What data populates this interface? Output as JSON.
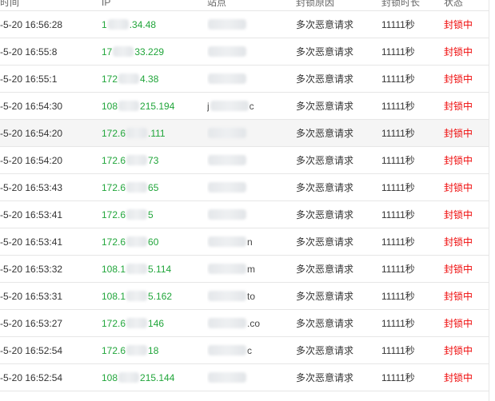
{
  "header": {
    "time": "时间",
    "ip": "IP",
    "site": "站点",
    "reason": "封锁原因",
    "duration": "封锁时长",
    "status": "状态"
  },
  "rows": [
    {
      "time": "-5-20 16:56:28",
      "ip_prefix": "1",
      "ip_suffix": ".34.48",
      "site_prefix": "",
      "site_suffix": "",
      "reason": "多次恶意请求",
      "duration": "11111秒",
      "status": "封锁中"
    },
    {
      "time": "-5-20 16:55:8",
      "ip_prefix": "17",
      "ip_suffix": "33.229",
      "site_prefix": "",
      "site_suffix": "",
      "reason": "多次恶意请求",
      "duration": "11111秒",
      "status": "封锁中"
    },
    {
      "time": "-5-20 16:55:1",
      "ip_prefix": "172",
      "ip_suffix": "4.38",
      "site_prefix": "",
      "site_suffix": "",
      "reason": "多次恶意请求",
      "duration": "11111秒",
      "status": "封锁中"
    },
    {
      "time": "-5-20 16:54:30",
      "ip_prefix": "108",
      "ip_suffix": "215.194",
      "site_prefix": "j",
      "site_suffix": "c",
      "reason": "多次恶意请求",
      "duration": "11111秒",
      "status": "封锁中"
    },
    {
      "time": "-5-20 16:54:20",
      "ip_prefix": "172.6",
      "ip_suffix": ".111",
      "site_prefix": "",
      "site_suffix": "",
      "reason": "多次恶意请求",
      "duration": "11111秒",
      "status": "封锁中"
    },
    {
      "time": "-5-20 16:54:20",
      "ip_prefix": "172.6",
      "ip_suffix": "73",
      "site_prefix": "",
      "site_suffix": "",
      "reason": "多次恶意请求",
      "duration": "11111秒",
      "status": "封锁中"
    },
    {
      "time": "-5-20 16:53:43",
      "ip_prefix": "172.6",
      "ip_suffix": "65",
      "site_prefix": "",
      "site_suffix": "",
      "reason": "多次恶意请求",
      "duration": "11111秒",
      "status": "封锁中"
    },
    {
      "time": "-5-20 16:53:41",
      "ip_prefix": "172.6",
      "ip_suffix": "5",
      "site_prefix": "",
      "site_suffix": "",
      "reason": "多次恶意请求",
      "duration": "11111秒",
      "status": "封锁中"
    },
    {
      "time": "-5-20 16:53:41",
      "ip_prefix": "172.6",
      "ip_suffix": "60",
      "site_prefix": "",
      "site_suffix": "n",
      "reason": "多次恶意请求",
      "duration": "11111秒",
      "status": "封锁中"
    },
    {
      "time": "-5-20 16:53:32",
      "ip_prefix": "108.1",
      "ip_suffix": "5.114",
      "site_prefix": "",
      "site_suffix": "m",
      "reason": "多次恶意请求",
      "duration": "11111秒",
      "status": "封锁中"
    },
    {
      "time": "-5-20 16:53:31",
      "ip_prefix": "108.1",
      "ip_suffix": "5.162",
      "site_prefix": "",
      "site_suffix": "to",
      "reason": "多次恶意请求",
      "duration": "11111秒",
      "status": "封锁中"
    },
    {
      "time": "-5-20 16:53:27",
      "ip_prefix": "172.6",
      "ip_suffix": "146",
      "site_prefix": "",
      "site_suffix": ".co",
      "reason": "多次恶意请求",
      "duration": "11111秒",
      "status": "封锁中"
    },
    {
      "time": "-5-20 16:52:54",
      "ip_prefix": "172.6",
      "ip_suffix": "18",
      "site_prefix": "",
      "site_suffix": "c",
      "reason": "多次恶意请求",
      "duration": "11111秒",
      "status": "封锁中"
    },
    {
      "time": "-5-20 16:52:54",
      "ip_prefix": "108",
      "ip_suffix": "215.144",
      "site_prefix": "",
      "site_suffix": "",
      "reason": "多次恶意请求",
      "duration": "11111秒",
      "status": "封锁中"
    }
  ],
  "colors": {
    "ip_text": "#20a53a",
    "status_text": "#ef0808",
    "row_border": "#e6e6e6",
    "highlight_row": "#f5f5f5"
  },
  "highlighted_row_index": 4
}
